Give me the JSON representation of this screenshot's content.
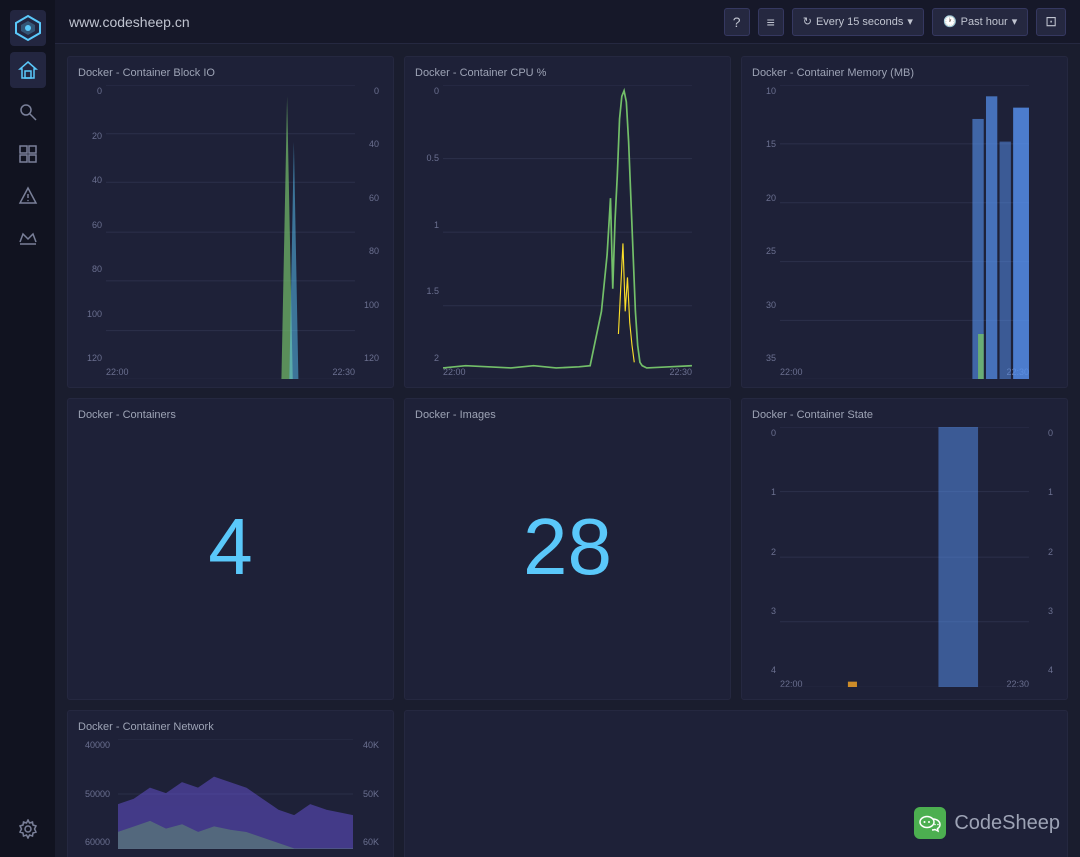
{
  "header": {
    "title": "www.codesheep.cn",
    "refresh_label": "Every 15 seconds",
    "timerange_label": "Past hour",
    "refresh_icon": "↻",
    "clock_icon": "🕐",
    "dropdown_icon": "▾",
    "help_icon": "?",
    "menu_icon": "≡",
    "share_icon": "⊡"
  },
  "sidebar": {
    "logo_text": "◈",
    "items": [
      {
        "id": "home",
        "icon": "◈",
        "active": true
      },
      {
        "id": "search",
        "icon": "⌖"
      },
      {
        "id": "dashboard",
        "icon": "⊞"
      },
      {
        "id": "alert",
        "icon": "⚠"
      },
      {
        "id": "crown",
        "icon": "♛"
      },
      {
        "id": "settings",
        "icon": "⚙"
      }
    ]
  },
  "panels": {
    "row1": [
      {
        "id": "block-io",
        "title": "Docker - Container Block IO",
        "type": "line",
        "y_labels_left": [
          "0",
          "20",
          "40",
          "60",
          "80",
          "100",
          "120"
        ],
        "y_labels_right": [
          "0",
          "40",
          "60",
          "80",
          "100",
          "120"
        ],
        "x_labels": [
          "22:00",
          "22:30"
        ]
      },
      {
        "id": "cpu",
        "title": "Docker - Container CPU %",
        "type": "line",
        "y_labels_left": [
          "0",
          "0.5",
          "1",
          "1.5",
          "2"
        ],
        "y_labels_right": [],
        "x_labels": [
          "22:00",
          "22:30"
        ]
      },
      {
        "id": "memory",
        "title": "Docker - Container Memory (MB)",
        "type": "line",
        "y_labels_left": [
          "10",
          "15",
          "20",
          "25",
          "30",
          "35"
        ],
        "y_labels_right": [],
        "x_labels": [
          "22:00",
          "22:30"
        ]
      }
    ],
    "row2": [
      {
        "id": "containers",
        "title": "Docker - Containers",
        "type": "number",
        "value": "4"
      },
      {
        "id": "images",
        "title": "Docker - Images",
        "type": "number",
        "value": "28"
      },
      {
        "id": "container-state",
        "title": "Docker - Container State",
        "type": "bar",
        "y_labels_left": [
          "0",
          "1",
          "2",
          "3",
          "4"
        ],
        "y_labels_right": [
          "0",
          "1",
          "2",
          "3",
          "4"
        ],
        "x_labels": [
          "22:00",
          "22:30"
        ]
      }
    ],
    "row3": [
      {
        "id": "network",
        "title": "Docker - Container Network",
        "type": "area",
        "y_labels_left": [
          "40000",
          "50000",
          "60000"
        ],
        "y_labels_right": [
          "40K",
          "50K",
          "60K"
        ],
        "x_labels": []
      }
    ]
  },
  "watermark": {
    "icon": "💬",
    "text": "CodeSheep"
  }
}
